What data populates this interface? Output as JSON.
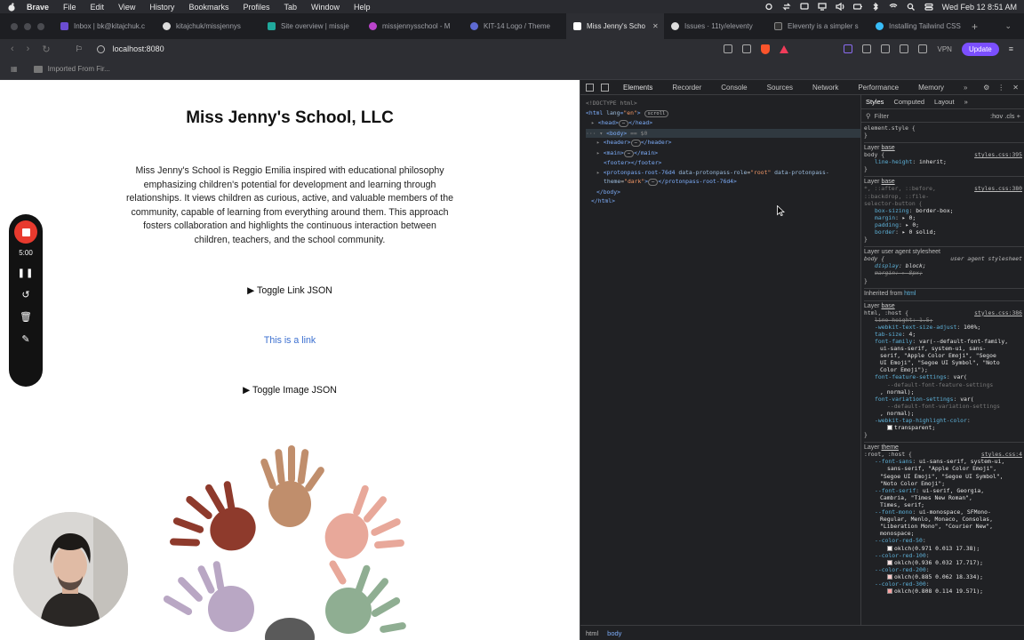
{
  "menubar": {
    "app": "Brave",
    "items": [
      "File",
      "Edit",
      "View",
      "History",
      "Bookmarks",
      "Profiles",
      "Tab",
      "Window",
      "Help"
    ],
    "datetime": "Wed Feb 12  8:51 AM"
  },
  "tabs": [
    {
      "label": "Inbox | bk@kitajchuk.c",
      "color": "#6b4dd1"
    },
    {
      "label": "kitajchuk/missjennys",
      "color": "#dddddd"
    },
    {
      "label": "Site overview | missje",
      "color": "#20a99c"
    },
    {
      "label": "missjennysschool - M",
      "color": "#bb44cc"
    },
    {
      "label": "KIT-14 Logo / Theme",
      "color": "#5e6ad2"
    },
    {
      "label": "Miss Jenny's Scho",
      "color": "#ffffff",
      "active": true
    },
    {
      "label": "Issues · 11ty/eleventy",
      "color": "#dddddd"
    },
    {
      "label": "Eleventy is a simpler s",
      "color": "#333333"
    },
    {
      "label": "Installing Tailwind CSS",
      "color": "#38bdf8"
    }
  ],
  "toolbar": {
    "url": "localhost:8080",
    "vpn": "VPN",
    "update": "Update"
  },
  "bookmarks": {
    "folder": "Imported From Fir..."
  },
  "page": {
    "title": "Miss Jenny's School, LLC",
    "description": "Miss Jenny's School is Reggio Emilia inspired with educational philosophy emphasizing children's potential for development and learning through relationships. It views children as curious, active, and valuable members of the community, capable of learning from everything around them. This approach fosters collaboration and highlights the continuous interaction between children, teachers, and the school community.",
    "toggle_link": "▶ Toggle Link JSON",
    "link": "This is a link",
    "toggle_image": "▶ Toggle Image JSON"
  },
  "recorder": {
    "time": "5:00"
  },
  "devtools": {
    "tabs": [
      "Elements",
      "Recorder",
      "Console",
      "Sources",
      "Network",
      "Performance",
      "Memory"
    ],
    "more": "»",
    "styles_tabs": [
      "Styles",
      "Computed",
      "Layout",
      "»"
    ],
    "filter": "Filter",
    "filter_right": ":hov  .cls  +",
    "elements": {
      "doctype": "<!DOCTYPE html>",
      "html_open": "html",
      "html_lang": "en",
      "scroll": "scroll",
      "head": "<head>",
      "head_close": "</head>",
      "body": "<body>",
      "body_eq": "== $0",
      "header": "<header>",
      "header_close": "</header>",
      "main": "<main>",
      "main_close": "</main>",
      "footer": "<footer></footer>",
      "proton_tag": "<protonpass-root-76d4",
      "proton_attr1": "data-protonpass-role",
      "proton_val1": "\"root\"",
      "proton_attr2": "data-protonpass-",
      "proton_attr2b": "theme",
      "proton_val2": "\"dark\"",
      "proton_close": "</protonpass-root-76d4>",
      "body_close": "</body>",
      "html_close": "</html>",
      "ellipsis": "⋯"
    },
    "styles": {
      "element_style": "element.style {",
      "brace": "}",
      "layer_label": "Layer",
      "layer_base": "base",
      "layer_theme": "theme",
      "body_sel": "body {",
      "src_395": "styles.css:395",
      "line_height": "line-height",
      "inherit": "inherit;",
      "universal_sel1": "*, ::after, ::before,",
      "universal_sel2": "::backdrop, ::file-",
      "universal_sel3": "selector-button {",
      "src_380": "styles.css:380",
      "box_sizing": "box-sizing",
      "border_box": "border-box;",
      "margin": "margin",
      "zero": "▸ 0;",
      "padding": "padding",
      "border": "border",
      "border_val": "▸ 0 solid;",
      "ua_label": "Layer user agent stylesheet",
      "ua_right": "user agent stylesheet",
      "display": "display",
      "block": "block;",
      "margin_ua": "margin: ▸ 8px;",
      "inherited": "Inherited from",
      "inherited_html": "html",
      "html_sel": "html,  :host {",
      "src_386": "styles.css:386",
      "lh_strike": "line-height: 1.5;",
      "wtsa": "-webkit-text-size-adjust",
      "pct100": "100%;",
      "tab_size": "tab-size",
      "four": "4;",
      "font_family": "font-family",
      "ff_1": "var(--default-font-family,",
      "ff_2": "ui-sans-serif, system-ui, sans-",
      "ff_3": "serif, \"Apple Color Emoji\", \"Segoe",
      "ff_4": "UI Emoji\", \"Segoe UI Symbol\", \"Noto",
      "ff_5": "Color Emoji\");",
      "ffs": "font-feature-settings",
      "ffs_1": "var(",
      "ffs_2": "--default-font-feature-settings",
      "ffs_3": ", normal);",
      "fvs": "font-variation-settings",
      "fvs_2": "--default-font-variation-settings",
      "thc": "-webkit-tap-highlight-color",
      "transparent": "transparent;",
      "root_sel": ":root,  :host {",
      "src_4": "styles.css:4",
      "font_sans": "--font-sans",
      "fs_1": "ui-sans-serif, system-ui,",
      "fs_2": "sans-serif, \"Apple Color Emoji\",",
      "fs_3": "\"Segoe UI Emoji\", \"Segoe UI Symbol\",",
      "fs_4": "\"Noto Color Emoji\";",
      "font_serif": "--font-serif",
      "fse_1": "ui-serif, Georgia,",
      "fse_2": "Cambria, \"Times New Roman\",",
      "fse_3": "Times, serif;",
      "font_mono": "--font-mono",
      "fm_1": "ui-monospace, SFMono-",
      "fm_2": "Regular, Menlo, Monaco, Consolas,",
      "fm_3": "\"Liberation Mono\", \"Courier New\",",
      "fm_4": "monospace;",
      "colors": [
        {
          "name": "--color-red-50",
          "value": "oklch(0.971 0.013 17.38);",
          "swatch": "#fdf1f1"
        },
        {
          "name": "--color-red-100",
          "value": "oklch(0.936 0.032 17.717);",
          "swatch": "#fde2e2"
        },
        {
          "name": "--color-red-200",
          "value": "oklch(0.885 0.062 18.334);",
          "swatch": "#fcc9c9"
        },
        {
          "name": "--color-red-300",
          "value": "oklch(0.808 0.114 19.571);",
          "swatch": "#f9a2a2"
        }
      ]
    },
    "breadcrumb": [
      "html",
      "body"
    ]
  },
  "colors": {
    "link": "#3b6fd0",
    "record": "#e83a2e",
    "update": "#7b4fff",
    "devtools_bg": "#202124"
  }
}
